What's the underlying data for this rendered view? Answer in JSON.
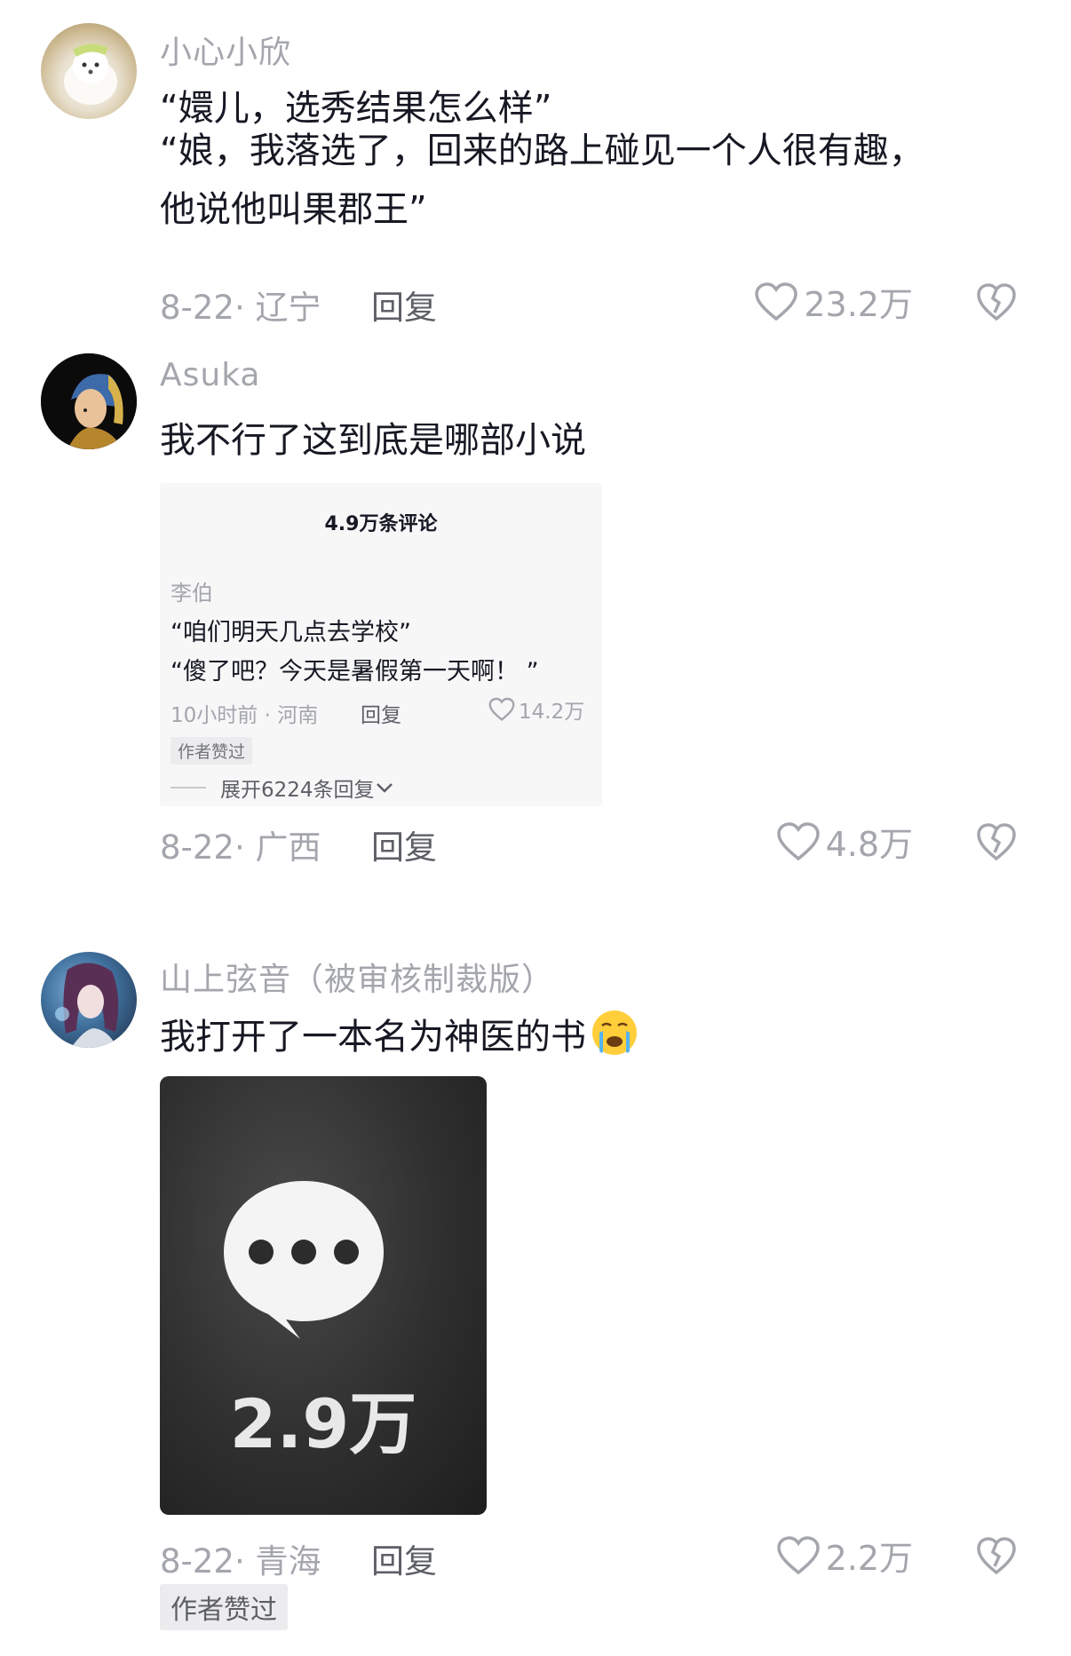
{
  "comments": [
    {
      "username": "小心小欣",
      "lines": [
        "“嬛儿，选秀结果怎么样”",
        "“娘，我落选了，回来的路上碰见一个人很有趣，",
        "他说他叫果郡王”"
      ],
      "date_location": "8-22· 辽宁",
      "reply_label": "回复",
      "likes": "23.2万"
    },
    {
      "username": "Asuka",
      "lines": [
        "我不行了这到底是哪部小说"
      ],
      "date_location": "8-22· 广西",
      "reply_label": "回复",
      "likes": "4.8万",
      "embedded": {
        "count_title": "4.9万条评论",
        "username": "李伯",
        "lines": [
          "“咱们明天几点去学校”",
          "“傻了吧？今天是暑假第一天啊！ ”"
        ],
        "date_location": "10小时前 · 河南",
        "reply_label": "回复",
        "likes": "14.2万",
        "badge": "作者赞过",
        "expand_label": "展开6224条回复"
      }
    },
    {
      "username": "山上弦音（被审核制裁版）",
      "lines": [
        "我打开了一本名为神医的书"
      ],
      "date_location": "8-22· 青海",
      "reply_label": "回复",
      "likes": "2.2万",
      "image_count": "2.9万",
      "badge": "作者赞过"
    }
  ],
  "colors": {
    "text": "#161823",
    "muted": "#a4a6ad",
    "reply": "#5d5f66"
  }
}
